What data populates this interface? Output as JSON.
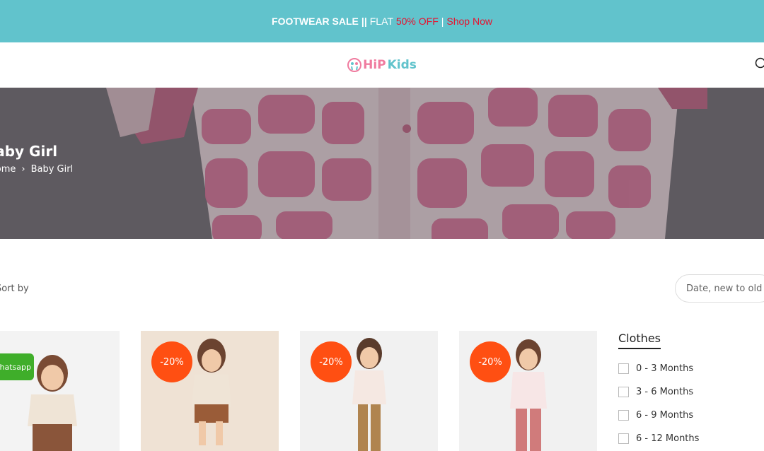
{
  "announcement": {
    "part1": "FOOTWEAR SALE",
    "sep1": "||",
    "part2": "FLAT",
    "highlight": "50% OFF",
    "pipe": "|",
    "link": "Shop Now",
    "bg_color": "#61c3cc",
    "highlight_color": "#e8102d"
  },
  "header": {
    "logo_hip": "HiP",
    "logo_kids": "Kids",
    "search_icon": "search-icon"
  },
  "hero": {
    "title": "Baby Girl",
    "breadcrumb": [
      "Home",
      "Baby Girl"
    ],
    "separator_icon": "chevron-right-icon"
  },
  "toolbar": {
    "sort_label": "Sort by",
    "sort_value": "Date, new to old"
  },
  "products": [
    {
      "badge": "",
      "whatsapp": "Whatsapp"
    },
    {
      "badge": "-20%"
    },
    {
      "badge": "-20%"
    },
    {
      "badge": "-20%"
    }
  ],
  "filter": {
    "title": "Clothes",
    "options": [
      "0 - 3 Months",
      "3 - 6 Months",
      "6 - 9 Months",
      "6 - 12 Months"
    ]
  },
  "colors": {
    "badge": "#ff4f12",
    "whatsapp": "#3fae2a"
  }
}
